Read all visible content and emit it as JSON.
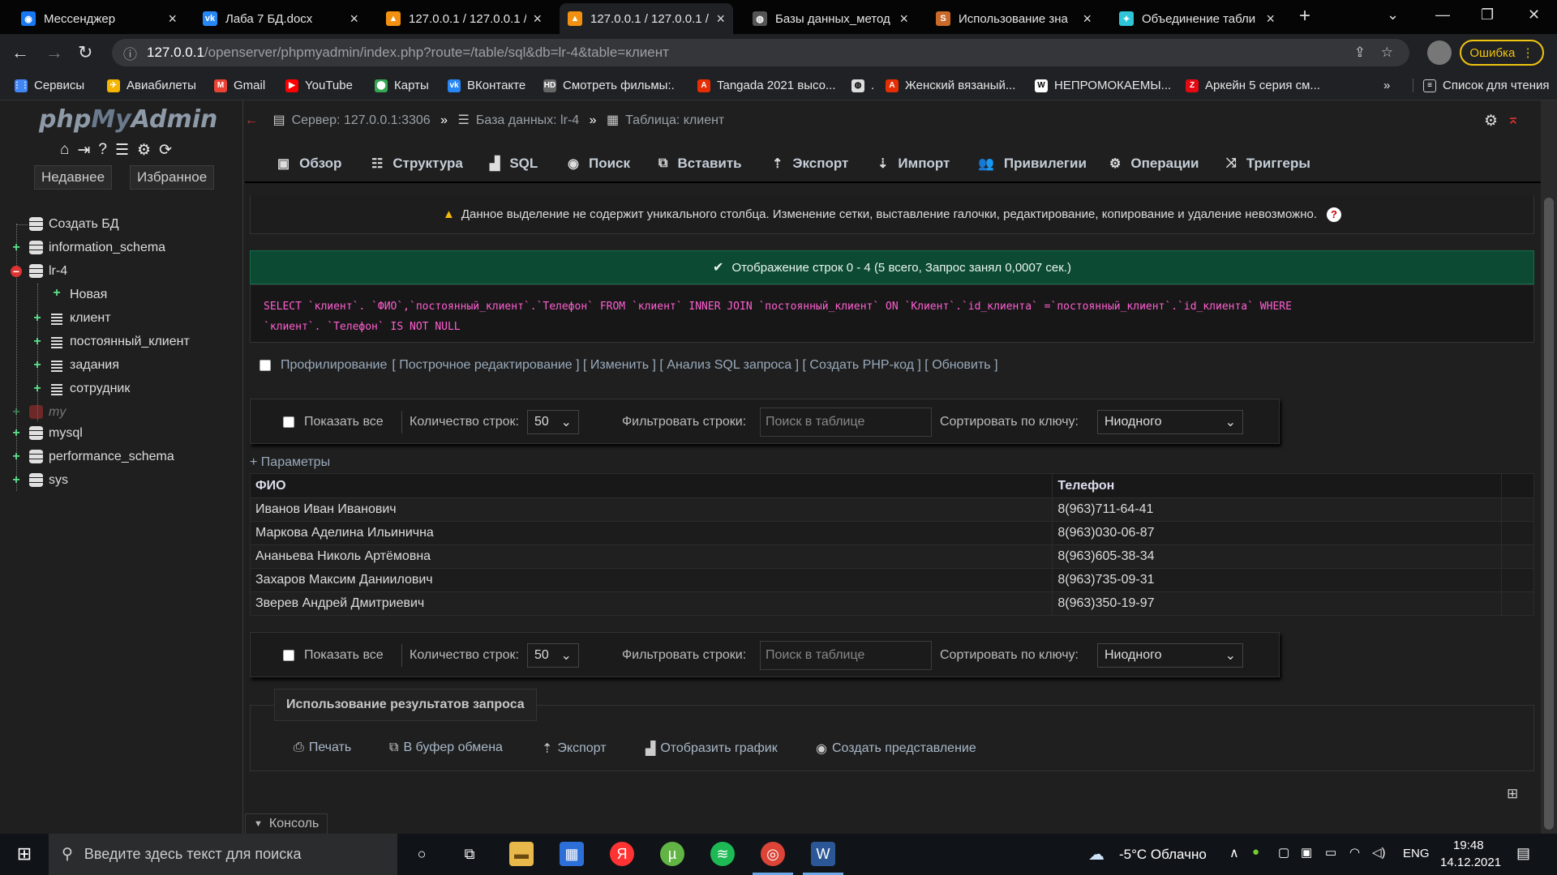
{
  "browser": {
    "tabs": [
      {
        "title": "Мессенджер",
        "icon": "messenger-icon",
        "color": "#1877f2"
      },
      {
        "title": "Лаба 7 БД.docx",
        "icon": "vk-icon",
        "color": "#2787f5"
      },
      {
        "title": "127.0.0.1 / 127.0.0.1 /",
        "icon": "phpmyadmin-icon",
        "color": "#f29111"
      },
      {
        "title": "127.0.0.1 / 127.0.0.1 /",
        "icon": "phpmyadmin-icon",
        "color": "#f29111"
      },
      {
        "title": "Базы данных_метод",
        "icon": "globe-icon",
        "color": "#888888"
      },
      {
        "title": "Использование зна",
        "icon": "studfile-icon",
        "color": "#c96a2b"
      },
      {
        "title": "Объединение табли",
        "icon": "sql-icon",
        "color": "#2ec5d8"
      }
    ],
    "url_host": "127.0.0.1",
    "url_path": "/openserver/phpmyadmin/index.php?route=/table/sql&db=lr-4&table=клиент",
    "error_label": "Ошибка",
    "bookmarks": [
      {
        "label": "Сервисы",
        "icon": "apps-icon",
        "color": "#4285f4"
      },
      {
        "label": "Авиабилеты",
        "icon": "plane-icon",
        "color": "#f4b400"
      },
      {
        "label": "Gmail",
        "icon": "gmail-icon",
        "color": "#ea4335"
      },
      {
        "label": "YouTube",
        "icon": "youtube-icon",
        "color": "#ff0000"
      },
      {
        "label": "Карты",
        "icon": "maps-icon",
        "color": "#34a853"
      },
      {
        "label": "ВКонтакте",
        "icon": "vk-icon",
        "color": "#2787f5"
      },
      {
        "label": "Смотреть фильмы:.",
        "icon": "hd-icon",
        "color": "#666666"
      },
      {
        "label": "Tangada 2021 высо...",
        "icon": "aliexpress-icon",
        "color": "#e62e04"
      },
      {
        "label": ".",
        "icon": "globe-icon",
        "color": "#dddddd"
      },
      {
        "label": "Женский вязаный...",
        "icon": "aliexpress-icon",
        "color": "#e62e04"
      },
      {
        "label": "НЕПРОМОКАЕМЫ...",
        "icon": "wb-icon",
        "color": "#ffffff"
      },
      {
        "label": "Аркейн 5 серия см...",
        "icon": "z-icon",
        "color": "#e50914"
      }
    ],
    "more_bookmarks": "»",
    "reading_list": "Список для чтения"
  },
  "pma": {
    "logo_php": "php",
    "logo_my": "My",
    "logo_admin": "Admin",
    "recent_tab": "Недавнее",
    "favorites_tab": "Избранное",
    "tree": [
      {
        "label": "Создать БД",
        "type": "new"
      },
      {
        "label": "information_schema",
        "type": "db"
      },
      {
        "label": "lr-4",
        "type": "db-open"
      },
      {
        "label": "Новая",
        "type": "new-table"
      },
      {
        "label": "клиент",
        "type": "table"
      },
      {
        "label": "постоянный_клиент",
        "type": "table"
      },
      {
        "label": "задания",
        "type": "table"
      },
      {
        "label": "сотрудник",
        "type": "table"
      },
      {
        "label": "my",
        "type": "db-hidden"
      },
      {
        "label": "mysql",
        "type": "db"
      },
      {
        "label": "performance_schema",
        "type": "db"
      },
      {
        "label": "sys",
        "type": "db"
      }
    ],
    "breadcrumb": {
      "server": "Сервер: 127.0.0.1:3306",
      "database": "База данных: lr-4",
      "table": "Таблица: клиент",
      "sep": "»"
    },
    "menu": [
      {
        "label": "Обзор",
        "icon": "browse-icon"
      },
      {
        "label": "Структура",
        "icon": "structure-icon"
      },
      {
        "label": "SQL",
        "icon": "sql-icon"
      },
      {
        "label": "Поиск",
        "icon": "search-icon"
      },
      {
        "label": "Вставить",
        "icon": "insert-icon"
      },
      {
        "label": "Экспорт",
        "icon": "export-icon"
      },
      {
        "label": "Импорт",
        "icon": "import-icon"
      },
      {
        "label": "Привилегии",
        "icon": "privileges-icon"
      },
      {
        "label": "Операции",
        "icon": "operations-icon"
      },
      {
        "label": "Триггеры",
        "icon": "triggers-icon"
      }
    ],
    "warning": "Данное выделение не содержит уникального столбца. Изменение сетки, выставление галочки, редактирование, копирование и удаление невозможно.",
    "success": "Отображение строк 0 - 4 (5 всего, Запрос занял 0,0007 сек.)",
    "sql_line1": "SELECT `клиент`. `ФИО`,`постоянный_клиент`.`Телефон` FROM `клиент` INNER JOIN `постоянный_клиент` ON `Клиент`.`id_клиента` =`постоянный_клиент`.`id_клиента` WHERE",
    "sql_line2": "`клиент`. `Телефон` IS NOT NULL",
    "profiling": "Профилирование",
    "profiling_links": "[ Построчное редактирование ] [ Изменить ] [ Анализ SQL запроса ] [ Создать PHP-код ] [ Обновить ]",
    "filter": {
      "show_all": "Показать все",
      "rows_label": "Количество строк:",
      "rows_value": "50",
      "filter_label": "Фильтровать строки:",
      "filter_placeholder": "Поиск в таблице",
      "sort_label": "Сортировать по ключу:",
      "sort_value": "Ниодного"
    },
    "params": "+ Параметры",
    "columns": [
      "ФИО",
      "Телефон"
    ],
    "rows": [
      [
        "Иванов Иван Иванович",
        "8(963)711-64-41"
      ],
      [
        "Маркова Аделина Ильинична",
        "8(963)030-06-87"
      ],
      [
        "Ананьева Николь Артёмовна",
        "8(963)605-38-34"
      ],
      [
        "Захаров Максим Даниилович",
        "8(963)735-09-31"
      ],
      [
        "Зверев Андрей Дмитриевич",
        "8(963)350-19-97"
      ]
    ],
    "usage_title": "Использование результатов запроса",
    "usage": [
      {
        "label": "Печать",
        "icon": "print-icon"
      },
      {
        "label": "В буфер обмена",
        "icon": "clipboard-icon"
      },
      {
        "label": "Экспорт",
        "icon": "export-icon"
      },
      {
        "label": "Отобразить график",
        "icon": "chart-icon"
      },
      {
        "label": "Создать представление",
        "icon": "eye-icon"
      }
    ],
    "console": "Консоль"
  },
  "taskbar": {
    "search_placeholder": "Введите здесь текст для поиска",
    "weather": "-5°C Облачно",
    "lang": "ENG",
    "time": "19:48",
    "date": "14.12.2021"
  }
}
